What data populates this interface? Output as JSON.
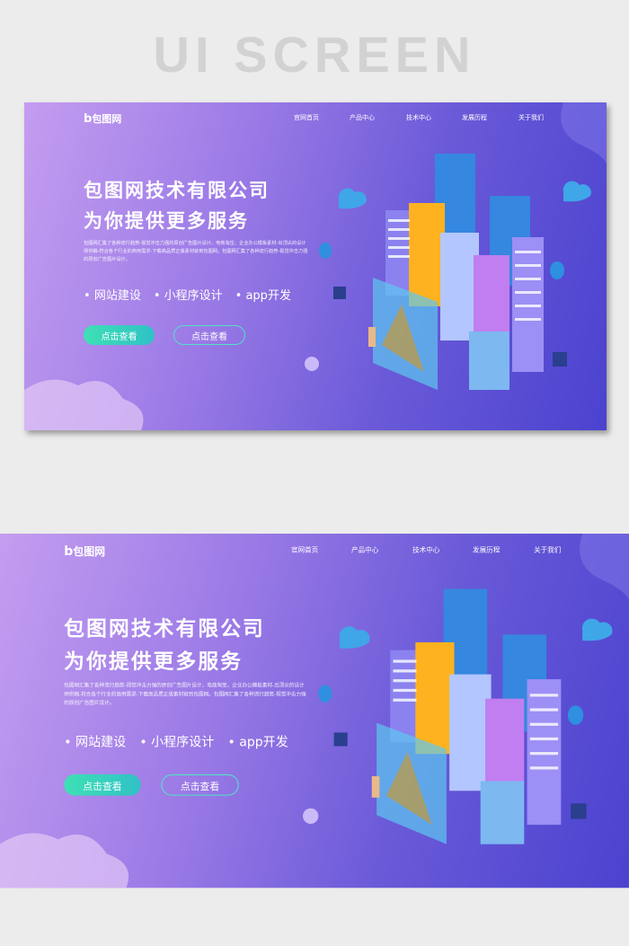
{
  "header": {
    "title": "UI SCREEN"
  },
  "banner": {
    "logo": {
      "mark": "b",
      "text": "包图网"
    },
    "nav": [
      "官网首页",
      "产品中心",
      "技术中心",
      "发展历程",
      "关于我们"
    ],
    "title_line1": "包图网技术有限公司",
    "title_line2": "为你提供更多服务",
    "paragraph": "包图网汇集了各种流行趋势-视觉冲击力强的原创广告图片设计，电商淘宝，企业办公模板素材-出顶尖的设计师供稿-符合各个行业的商用需求-下载高品质正版素材就到包图网。包图网汇集了各种流行趋势-视觉冲击力强的原创广告图片设计。",
    "features": [
      "网站建设",
      "小程序设计",
      "app开发"
    ],
    "buttons": [
      "点击查看",
      "点击查看"
    ],
    "colors": {
      "accent": "#3fe0b5",
      "bg_start": "#c49df0",
      "bg_end": "#4b42cf"
    }
  }
}
